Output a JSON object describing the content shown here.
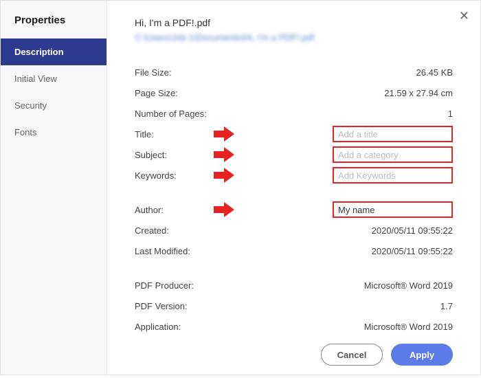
{
  "panelTitle": "Properties",
  "sidebar": {
    "items": [
      {
        "id": "description",
        "label": "Description",
        "active": true
      },
      {
        "id": "initial-view",
        "label": "Initial View",
        "active": false
      },
      {
        "id": "security",
        "label": "Security",
        "active": false
      },
      {
        "id": "fonts",
        "label": "Fonts",
        "active": false
      }
    ]
  },
  "header": {
    "filename": "Hi, I'm a PDF!.pdf",
    "filepath": "C:\\Users\\Job 1\\Documents\\Hi, I'm a PDF!.pdf"
  },
  "rows": {
    "fileSizeLabel": "File Size:",
    "fileSizeValue": "26.45 KB",
    "pageSizeLabel": "Page Size:",
    "pageSizeValue": "21.59 x 27.94 cm",
    "numPagesLabel": "Number of Pages:",
    "numPagesValue": "1",
    "titleLabel": "Title:",
    "titlePlaceholder": "Add a title",
    "titleValue": "",
    "subjectLabel": "Subject:",
    "subjectPlaceholder": "Add a category",
    "subjectValue": "",
    "keywordsLabel": "Keywords:",
    "keywordsPlaceholder": "Add Keywords",
    "keywordsValue": "",
    "authorLabel": "Author:",
    "authorValue": "My name",
    "createdLabel": "Created:",
    "createdValue": "2020/05/11 09:55:22",
    "modifiedLabel": "Last Modified:",
    "modifiedValue": "2020/05/11 09:55:22",
    "producerLabel": "PDF Producer:",
    "producerValue": "Microsoft® Word 2019",
    "versionLabel": "PDF Version:",
    "versionValue": "1.7",
    "applicationLabel": "Application:",
    "applicationValue": "Microsoft® Word 2019"
  },
  "buttons": {
    "cancel": "Cancel",
    "apply": "Apply"
  }
}
